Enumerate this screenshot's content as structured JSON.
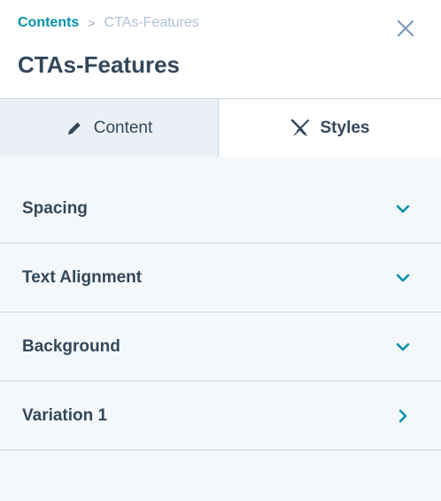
{
  "breadcrumb": {
    "root": "Contents",
    "separator": ">",
    "current": "CTAs-Features"
  },
  "title": "CTAs-Features",
  "tabs": [
    {
      "label": "Content",
      "icon": "pencil-icon",
      "active": false
    },
    {
      "label": "Styles",
      "icon": "paintbrush-icon",
      "active": true
    }
  ],
  "sections": [
    {
      "label": "Spacing",
      "icon": "chevron-down-icon"
    },
    {
      "label": "Text Alignment",
      "icon": "chevron-down-icon"
    },
    {
      "label": "Background",
      "icon": "chevron-down-icon"
    },
    {
      "label": "Variation 1",
      "icon": "chevron-right-icon"
    }
  ],
  "colors": {
    "accent": "#0091ae",
    "text": "#33475b",
    "muted": "#b0c1d4",
    "border": "#cbd6e2",
    "panel_bg": "#f5f8fa",
    "tab_inactive_bg": "#eaf0f6"
  }
}
